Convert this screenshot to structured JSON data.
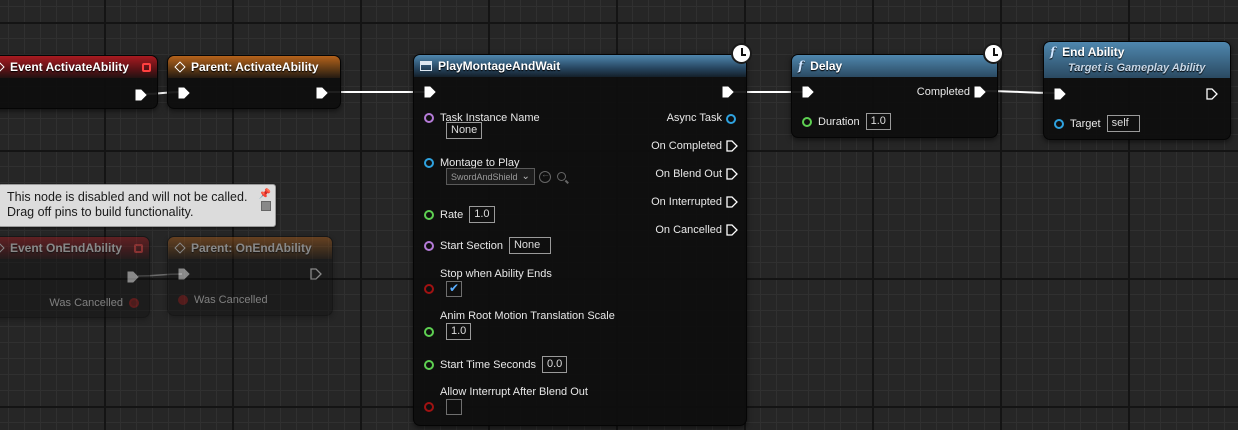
{
  "nodes": {
    "event_activate": {
      "title": "Event ActivateAbility"
    },
    "parent_activate": {
      "title": "Parent: ActivateAbility"
    },
    "play_montage": {
      "title": "PlayMontageAndWait",
      "inputs": {
        "task_instance_name": {
          "label": "Task Instance Name",
          "value": "None"
        },
        "montage_to_play": {
          "label": "Montage to Play",
          "value": "SwordAndShield"
        },
        "rate": {
          "label": "Rate",
          "value": "1.0"
        },
        "start_section": {
          "label": "Start Section",
          "value": "None"
        },
        "stop_when_ability_ends": {
          "label": "Stop when Ability Ends",
          "checked": true
        },
        "anim_root_motion": {
          "label": "Anim Root Motion Translation Scale",
          "value": "1.0"
        },
        "start_time_seconds": {
          "label": "Start Time Seconds",
          "value": "0.0"
        },
        "allow_interrupt": {
          "label": "Allow Interrupt After Blend Out",
          "checked": false
        }
      },
      "outputs": {
        "async_task": "Async Task",
        "on_completed": "On Completed",
        "on_blend_out": "On Blend Out",
        "on_interrupted": "On Interrupted",
        "on_cancelled": "On Cancelled"
      }
    },
    "delay": {
      "title": "Delay",
      "completed": "Completed",
      "duration": {
        "label": "Duration",
        "value": "1.0"
      }
    },
    "end_ability": {
      "title": "End Ability",
      "subtitle": "Target is Gameplay Ability",
      "target": {
        "label": "Target",
        "value": "self"
      }
    },
    "event_end": {
      "title": "Event OnEndAbility",
      "was_cancelled": "Was Cancelled"
    },
    "parent_end": {
      "title": "Parent: OnEndAbility",
      "was_cancelled": "Was Cancelled"
    }
  },
  "tooltip": {
    "line1": "This node is disabled and will not be called.",
    "line2": "Drag off pins to build functionality."
  },
  "colors": {
    "event_header": "#a81a20",
    "parent_header": "#b5621b",
    "function_header": "#4f87ae",
    "exec_wire": "#ffffff",
    "object_pin": "#2fa3e0",
    "float_pin": "#5ed052",
    "name_pin": "#b57bd8",
    "bool_pin": "#a01212"
  }
}
